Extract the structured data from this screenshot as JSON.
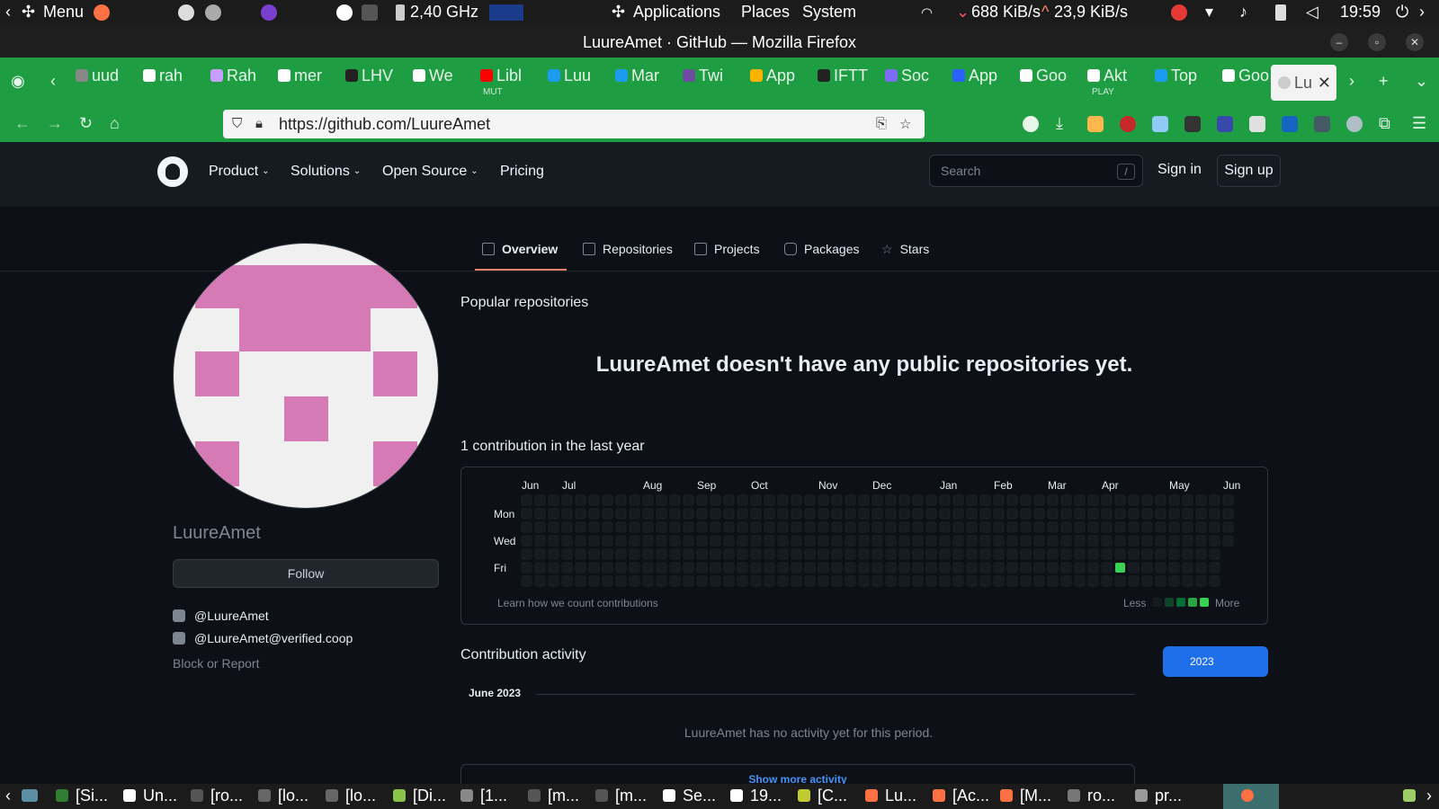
{
  "os_panel": {
    "menu_label": "Menu",
    "cpu": "2,40 GHz",
    "applications": "Applications",
    "places": "Places",
    "system": "System",
    "net_down": "688 KiB/s",
    "net_up": "23,9 KiB/s",
    "time": "19:59"
  },
  "window": {
    "title": "LuureAmet · GitHub — Mozilla Firefox"
  },
  "tabs": [
    {
      "label": "uud",
      "color": "#888888"
    },
    {
      "label": "rah",
      "color": "#ffffff"
    },
    {
      "label": "Rah",
      "color": "#c7a0ff"
    },
    {
      "label": "mer",
      "color": "#ffffff"
    },
    {
      "label": "LHV",
      "color": "#222222"
    },
    {
      "label": "We",
      "color": "#ffffff"
    },
    {
      "label": "Libl",
      "color": "#ff0000"
    },
    {
      "label": "Luu",
      "color": "#1d9bf0"
    },
    {
      "label": "Mar",
      "color": "#1d9bf0"
    },
    {
      "label": "Twi",
      "color": "#6d4c9f"
    },
    {
      "label": "App",
      "color": "#ffb300"
    },
    {
      "label": "IFTT",
      "color": "#222222"
    },
    {
      "label": "Soc",
      "color": "#7b6cf6"
    },
    {
      "label": "App",
      "color": "#2962ff"
    },
    {
      "label": "Goo",
      "color": "#ffffff"
    },
    {
      "label": "Akt",
      "color": "#ffffff"
    },
    {
      "label": "Top",
      "color": "#1d9bf0"
    },
    {
      "label": "Goo",
      "color": "#ffffff"
    }
  ],
  "active_tab": {
    "label": "Lu"
  },
  "tab_sublabels": {
    "libl": "MUT",
    "akt": "PLAY"
  },
  "url": "https://github.com/LuureAmet",
  "gh_header": {
    "nav": [
      "Product",
      "Solutions",
      "Open Source",
      "Pricing"
    ],
    "search_placeholder": "Search",
    "search_kbd": "/",
    "sign_in": "Sign in",
    "sign_up": "Sign up"
  },
  "profile_tabs": [
    "Overview",
    "Repositories",
    "Projects",
    "Packages",
    "Stars"
  ],
  "profile": {
    "username": "LuureAmet",
    "follow": "Follow",
    "twitter": "@LuureAmet",
    "mastodon": "@LuureAmet@verified.coop",
    "block": "Block or Report"
  },
  "main": {
    "popular_heading": "Popular repositories",
    "no_repos": "LuureAmet doesn't have any public repositories yet.",
    "contrib_heading": "1 contribution in the last year",
    "learn_link": "Learn how we count contributions",
    "less": "Less",
    "more": "More",
    "activity_heading": "Contribution activity",
    "year": "2023",
    "month": "June 2023",
    "no_activity": "LuureAmet has no activity yet for this period.",
    "show_more": "Show more activity"
  },
  "calendar": {
    "months": [
      "Jun",
      "Jul",
      "Aug",
      "Sep",
      "Oct",
      "Nov",
      "Dec",
      "Jan",
      "Feb",
      "Mar",
      "Apr",
      "May",
      "Jun"
    ],
    "days": [
      "Mon",
      "Wed",
      "Fri"
    ],
    "contribution_count": 1,
    "contribution_cell": {
      "week": 44,
      "day": 5
    }
  },
  "taskbar": [
    {
      "label": "[Si...",
      "color": "#2e7d32"
    },
    {
      "label": "Un...",
      "color": "#ffffff"
    },
    {
      "label": "[ro...",
      "color": "#555555"
    },
    {
      "label": "[lo...",
      "color": "#666666"
    },
    {
      "label": "[lo...",
      "color": "#666666"
    },
    {
      "label": "[Di...",
      "color": "#8bc34a"
    },
    {
      "label": "[1...",
      "color": "#888888"
    },
    {
      "label": "[m...",
      "color": "#555555"
    },
    {
      "label": "[m...",
      "color": "#555555"
    },
    {
      "label": "Se...",
      "color": "#ffffff"
    },
    {
      "label": "19...",
      "color": "#ffffff"
    },
    {
      "label": "[C...",
      "color": "#c0ca33"
    },
    {
      "label": "Lu...",
      "color": "#ff7043"
    },
    {
      "label": "[Ac...",
      "color": "#ff7043"
    },
    {
      "label": "[M...",
      "color": "#ff7043"
    },
    {
      "label": "ro...",
      "color": "#777777"
    },
    {
      "label": "pr...",
      "color": "#999999"
    }
  ]
}
